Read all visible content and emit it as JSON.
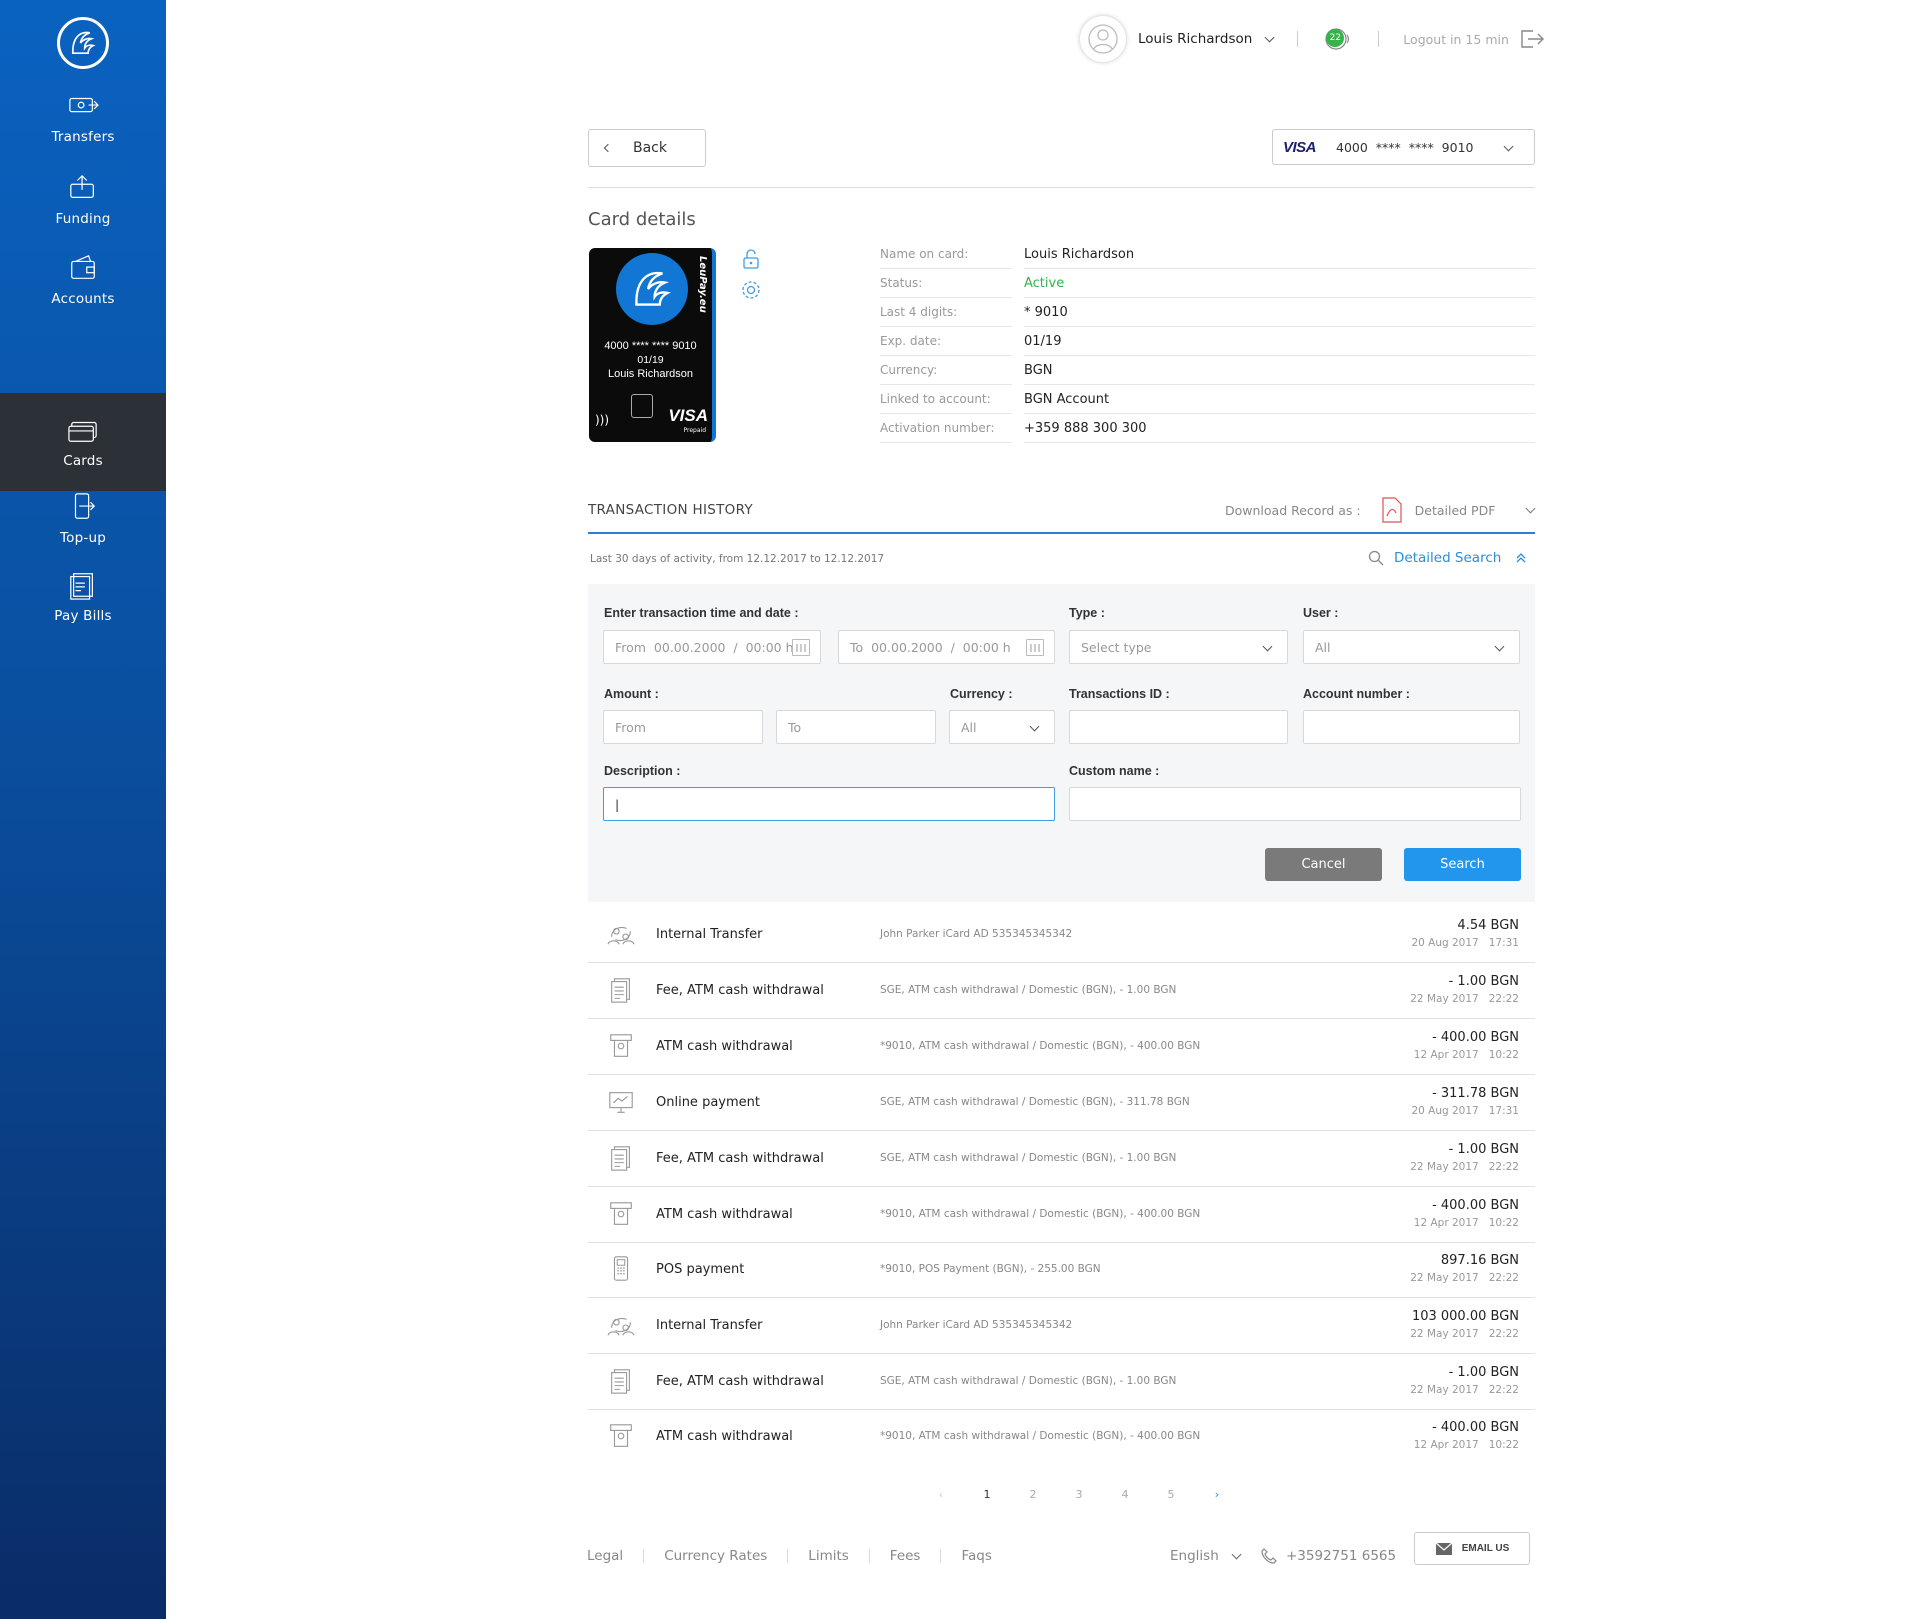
{
  "sidebar": {
    "items": [
      {
        "label": "Transfers",
        "icon": "transfers-icon"
      },
      {
        "label": "Funding",
        "icon": "funding-icon"
      },
      {
        "label": "Accounts",
        "icon": "accounts-icon"
      },
      {
        "label": "Cards",
        "icon": "cards-icon",
        "active": true
      },
      {
        "label": "Top-up",
        "icon": "topup-icon"
      },
      {
        "label": "Pay Bills",
        "icon": "paybills-icon"
      }
    ]
  },
  "topbar": {
    "user_name": "Louis Richardson",
    "notifications_count": "22",
    "logout_text": "Logout in 15 min"
  },
  "nav": {
    "back_label": "Back",
    "card_selector": {
      "brand": "VISA",
      "number": "4000  ****  ****  9010"
    }
  },
  "card_details": {
    "title": "Card details",
    "card_visual": {
      "brand_vertical": "LeuPay.eu",
      "number": "4000 **** **** 9010",
      "expiry": "01/19",
      "holder": "Louis Richardson",
      "network": "VISA",
      "network_sub": "Prepaid"
    },
    "rows": [
      {
        "label": "Name on card:",
        "value": "Louis Richardson"
      },
      {
        "label": "Status:",
        "value": "Active"
      },
      {
        "label": "Last 4 digits:",
        "value": "* 9010"
      },
      {
        "label": "Exp. date:",
        "value": "01/19"
      },
      {
        "label": "Currency:",
        "value": "BGN"
      },
      {
        "label": "Linked to account:",
        "value": "BGN Account"
      },
      {
        "label": "Activation number:",
        "value": "+359 888 300 300"
      }
    ],
    "status_color": "#30b34a"
  },
  "history": {
    "title": "TRANSACTION HISTORY",
    "download_label": "Download Record as :",
    "download_format": "Detailed PDF",
    "range_text": "Last 30 days of activity, from 12.12.2017 to 12.12.2017",
    "detailed_search_label": "Detailed Search"
  },
  "search_form": {
    "datetime_label": "Enter transaction time and date :",
    "from_placeholder": "From  00.00.2000  /  00:00 h",
    "to_placeholder": "To  00.00.2000  /  00:00 h",
    "type_label": "Type :",
    "type_value": "Select type",
    "user_label": "User :",
    "user_value": "All",
    "amount_label": "Amount :",
    "amount_from": "From",
    "amount_to": "To",
    "currency_label": "Currency :",
    "currency_value": "All",
    "txid_label": "Transactions ID :",
    "account_label": "Account number :",
    "description_label": "Description :",
    "description_value": "|",
    "custom_name_label": "Custom name :",
    "cancel_label": "Cancel",
    "search_label": "Search"
  },
  "transactions": [
    {
      "icon": "transfer-icon",
      "title": "Internal Transfer",
      "desc": "John Parker  iCard AD 535345345342",
      "amount": "4.54 BGN",
      "date": "20 Aug 2017   17:31"
    },
    {
      "icon": "document-icon",
      "title": "Fee, ATM cash withdrawal",
      "desc": "SGE, ATM cash withdrawal / Domestic (BGN), - 1.00 BGN",
      "amount": "- 1.00 BGN",
      "date": "22 May 2017   22:22"
    },
    {
      "icon": "atm-icon",
      "title": "ATM cash withdrawal",
      "desc": "*9010, ATM cash withdrawal / Domestic (BGN), - 400.00 BGN",
      "amount": "- 400.00 BGN",
      "date": "12 Apr 2017   10:22"
    },
    {
      "icon": "monitor-icon",
      "title": "Online payment",
      "desc": "SGE, ATM cash withdrawal / Domestic (BGN), - 311.78 BGN",
      "amount": "- 311.78 BGN",
      "date": "20 Aug 2017   17:31"
    },
    {
      "icon": "document-icon",
      "title": "Fee, ATM cash withdrawal",
      "desc": "SGE, ATM cash withdrawal / Domestic (BGN), - 1.00 BGN",
      "amount": "- 1.00 BGN",
      "date": "22 May 2017   22:22"
    },
    {
      "icon": "atm-icon",
      "title": "ATM cash withdrawal",
      "desc": "*9010, ATM cash withdrawal / Domestic (BGN), - 400.00 BGN",
      "amount": "- 400.00 BGN",
      "date": "12 Apr 2017   10:22"
    },
    {
      "icon": "pos-icon",
      "title": "POS payment",
      "desc": "*9010, POS Payment (BGN), - 255.00 BGN",
      "amount": "897.16 BGN",
      "date": "22 May 2017   22:22"
    },
    {
      "icon": "transfer-icon",
      "title": "Internal Transfer",
      "desc": "John Parker  iCard AD 535345345342",
      "amount": "103 000.00 BGN",
      "date": "22 May 2017   22:22"
    },
    {
      "icon": "document-icon",
      "title": "Fee, ATM cash withdrawal",
      "desc": "SGE, ATM cash withdrawal / Domestic (BGN), - 1.00 BGN",
      "amount": "- 1.00 BGN",
      "date": "22 May 2017   22:22"
    },
    {
      "icon": "atm-icon",
      "title": "ATM cash withdrawal",
      "desc": "*9010, ATM cash withdrawal / Domestic (BGN), - 400.00 BGN",
      "amount": "- 400.00 BGN",
      "date": "12 Apr 2017   10:22"
    }
  ],
  "pagination": {
    "pages": [
      "1",
      "2",
      "3",
      "4",
      "5"
    ],
    "current": "1",
    "prev": "‹",
    "next": "›"
  },
  "footer": {
    "links": [
      "Legal",
      "Currency Rates",
      "Limits",
      "Fees",
      "Faqs"
    ],
    "language": "English",
    "phone": "+3592751 6565",
    "email_label": "EMAIL US"
  },
  "colors": {
    "sidebar_top": "#0a62c0",
    "sidebar_bottom": "#0a2c67",
    "accent": "#2196ec",
    "active_nav": "#2c3138"
  }
}
